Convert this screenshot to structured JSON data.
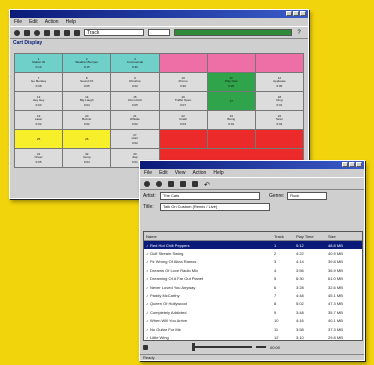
{
  "window1": {
    "menu": [
      "File",
      "Edit",
      "Action",
      "Help"
    ],
    "combo_value": "Track",
    "section_label": "Cart Display",
    "cells": [
      {
        "color": "blue",
        "num": "1",
        "name": "Station ID",
        "time": "0:10"
      },
      {
        "color": "blue",
        "num": "2",
        "name": "Weather Bumper",
        "time": "0:15"
      },
      {
        "color": "blue",
        "num": "3",
        "name": "Commercial",
        "time": "0:30"
      },
      {
        "color": "pink",
        "num": "",
        "name": "",
        "time": ""
      },
      {
        "color": "pink",
        "num": "",
        "name": "",
        "time": ""
      },
      {
        "color": "pink",
        "num": "",
        "name": "",
        "time": ""
      },
      {
        "color": "gray",
        "num": "7",
        "name": "Go Monkey",
        "time": "0:08"
      },
      {
        "color": "gray",
        "num": "8",
        "name": "Sound FX",
        "time": "0:05"
      },
      {
        "color": "gray",
        "num": "9",
        "name": "Rimshot",
        "time": "0:02"
      },
      {
        "color": "gray",
        "num": "10",
        "name": "Promo",
        "time": "0:30"
      },
      {
        "color": "green",
        "num": "11",
        "name": "Play Now",
        "time": "0:20"
      },
      {
        "color": "gray",
        "num": "12",
        "name": "Applause",
        "time": "0:06"
      },
      {
        "color": "gray",
        "num": "13",
        "name": "Hey Hey",
        "time": "0:03"
      },
      {
        "color": "gray",
        "num": "14",
        "name": "Big Laugh",
        "time": "0:04"
      },
      {
        "color": "gray",
        "num": "15",
        "name": "Drum Roll",
        "time": "0:05"
      },
      {
        "color": "gray",
        "num": "16",
        "name": "Traffic Open",
        "time": "0:07"
      },
      {
        "color": "green",
        "num": "17",
        "name": "",
        "time": ""
      },
      {
        "color": "gray",
        "num": "18",
        "name": "Ding",
        "time": "0:01"
      },
      {
        "color": "gray",
        "num": "19",
        "name": "Laser",
        "time": "0:02"
      },
      {
        "color": "gray",
        "num": "20",
        "name": "Buzzer",
        "time": "0:02"
      },
      {
        "color": "gray",
        "num": "21",
        "name": "Whistle",
        "time": "0:02"
      },
      {
        "color": "gray",
        "num": "22",
        "name": "Crash",
        "time": "0:03"
      },
      {
        "color": "gray",
        "num": "23",
        "name": "Boing",
        "time": "0:01"
      },
      {
        "color": "gray",
        "num": "24",
        "name": "Siren",
        "time": "0:04"
      },
      {
        "color": "yellow",
        "num": "25",
        "name": "",
        "time": ""
      },
      {
        "color": "yellow",
        "num": "26",
        "name": "",
        "time": ""
      },
      {
        "color": "gray",
        "num": "27",
        "name": "Horn",
        "time": "0:02"
      },
      {
        "color": "red",
        "num": "",
        "name": "",
        "time": ""
      },
      {
        "color": "red",
        "num": "",
        "name": "",
        "time": ""
      },
      {
        "color": "red",
        "num": "",
        "name": "",
        "time": ""
      },
      {
        "color": "gray",
        "num": "31",
        "name": "Cheer",
        "time": "0:05"
      },
      {
        "color": "gray",
        "num": "32",
        "name": "Gong",
        "time": "0:04"
      },
      {
        "color": "gray",
        "num": "33",
        "name": "Zap",
        "time": "0:01"
      },
      {
        "color": "redspan",
        "num": "",
        "name": "",
        "time": ""
      }
    ]
  },
  "window2": {
    "menu": [
      "File",
      "Edit",
      "View",
      "Action",
      "Help"
    ],
    "fields": {
      "label1": "Artist:",
      "value1": "The Cats",
      "label2": "Title:",
      "value2": "Talk On Custom (Remix / Live)",
      "label3": "Genre:",
      "value3": "Rock"
    },
    "list_headers": [
      "Name",
      "Track",
      "Play Time",
      "Size"
    ],
    "rows": [
      {
        "title": "Red Hot Chili Peppers",
        "track": "1",
        "time": "5:12",
        "size": "48.8 MB",
        "selected": true
      },
      {
        "title": "Gulf Stream Swing",
        "track": "2",
        "time": "4:22",
        "size": "40.9 MB",
        "selected": false
      },
      {
        "title": "Fir Wrong Of Alina Ramos",
        "track": "3",
        "time": "4:14",
        "size": "39.8 MB",
        "selected": false
      },
      {
        "title": "Dreams Of Love Radio Mix",
        "track": "4",
        "time": "3:56",
        "size": "36.9 MB",
        "selected": false
      },
      {
        "title": "Dreaming Of A Far Out Planet",
        "track": "5",
        "time": "6:30",
        "size": "61.0 MB",
        "selected": false
      },
      {
        "title": "Never Loved You Anyway",
        "track": "6",
        "time": "3:28",
        "size": "32.6 MB",
        "selected": false
      },
      {
        "title": "Paddy McCarthy",
        "track": "7",
        "time": "4:48",
        "size": "45.1 MB",
        "selected": false
      },
      {
        "title": "Queen Of Hollywood",
        "track": "8",
        "time": "5:02",
        "size": "47.3 MB",
        "selected": false
      },
      {
        "title": "Completely Addicted",
        "track": "9",
        "time": "3:48",
        "size": "35.7 MB",
        "selected": false
      },
      {
        "title": "When Will You Arrive",
        "track": "10",
        "time": "4:16",
        "size": "40.1 MB",
        "selected": false
      },
      {
        "title": "No Guitar For Me",
        "track": "11",
        "time": "3:58",
        "size": "37.3 MB",
        "selected": false
      },
      {
        "title": "Little Wing",
        "track": "12",
        "time": "3:10",
        "size": "29.8 MB",
        "selected": false
      }
    ],
    "time_readout": "00:00",
    "status": "Ready"
  }
}
